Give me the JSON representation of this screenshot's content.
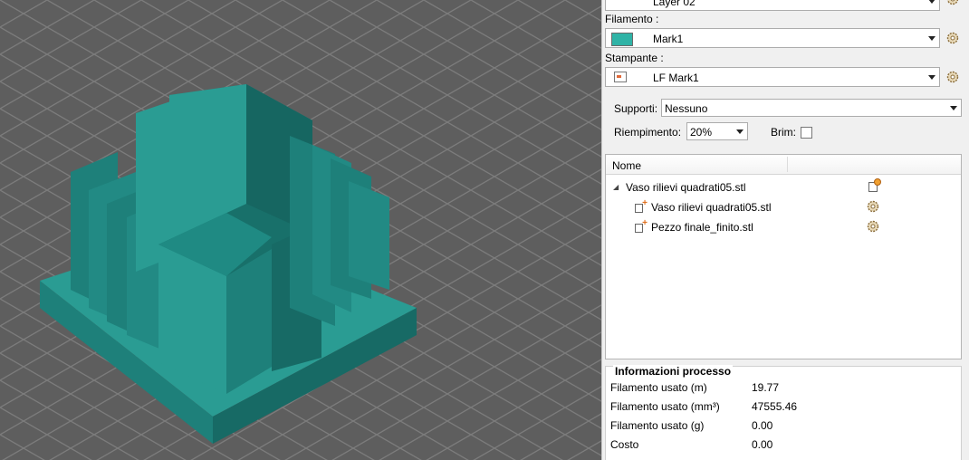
{
  "panel": {
    "layer_combo": {
      "value": "Layer 02"
    },
    "filament": {
      "label": "Filamento :",
      "value": "Mark1",
      "swatch_color": "#2fb3a6"
    },
    "printer": {
      "label": "Stampante :",
      "value": "LF Mark1"
    },
    "supports": {
      "label": "Supporti:",
      "value": "Nessuno"
    },
    "infill": {
      "label": "Riempimento:",
      "value": "20%"
    },
    "brim": {
      "label": "Brim:",
      "checked": false
    }
  },
  "tree": {
    "header": "Nome",
    "items": [
      {
        "label": "Vaso rilievi quadrati05.stl",
        "level": 0
      },
      {
        "label": "Vaso rilievi quadrati05.stl",
        "level": 1
      },
      {
        "label": "Pezzo finale_finito.stl",
        "level": 1
      }
    ]
  },
  "info": {
    "title": "Informazioni processo",
    "rows": [
      {
        "label": "Filamento usato (m)",
        "value": "19.77"
      },
      {
        "label": "Filamento usato (mm³)",
        "value": "47555.46"
      },
      {
        "label": "Filamento usato (g)",
        "value": "0.00"
      },
      {
        "label": "Costo",
        "value": "0.00"
      }
    ]
  },
  "colors": {
    "model_top": "#2a9c93",
    "model_left": "#1e807a",
    "model_right": "#176a65",
    "grid_bg": "#5e5e5e",
    "grid_line": "#7c7c7c"
  }
}
